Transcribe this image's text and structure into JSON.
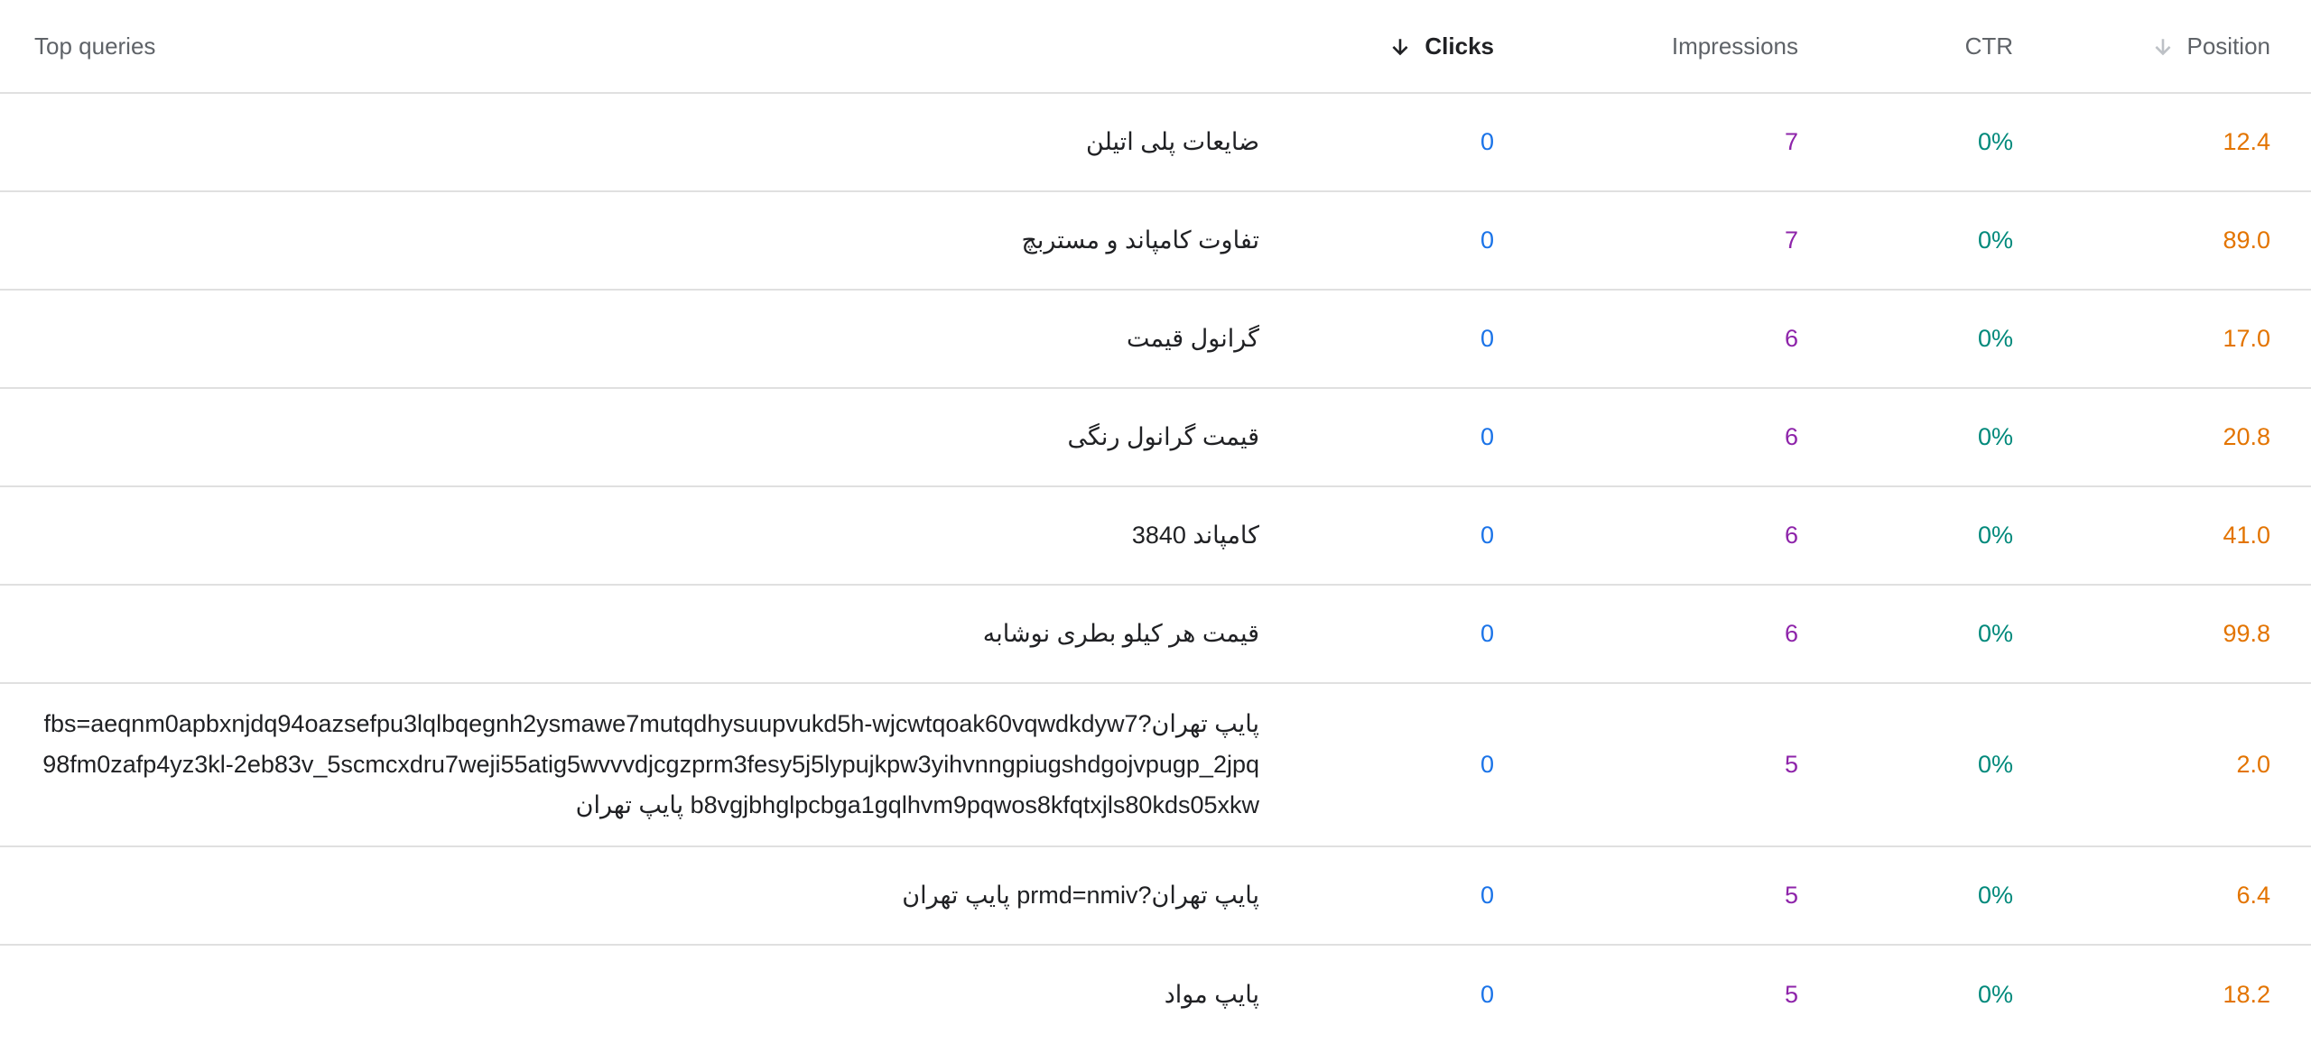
{
  "header": {
    "query_label": "Top queries",
    "clicks_label": "Clicks",
    "impressions_label": "Impressions",
    "ctr_label": "CTR",
    "position_label": "Position"
  },
  "icons": {
    "clicks_sort": "arrow-down-icon",
    "position_sort": "arrow-down-icon"
  },
  "colors": {
    "clicks": "#1a73e8",
    "impressions": "#8e24aa",
    "ctr": "#00897b",
    "position": "#e37400"
  },
  "rows": [
    {
      "query": "ضایعات پلی اتیلن",
      "clicks": "0",
      "impressions": "7",
      "ctr": "0%",
      "position": "12.4"
    },
    {
      "query": "تفاوت کامپاند و مستربچ",
      "clicks": "0",
      "impressions": "7",
      "ctr": "0%",
      "position": "89.0"
    },
    {
      "query": "گرانول قیمت",
      "clicks": "0",
      "impressions": "6",
      "ctr": "0%",
      "position": "17.0"
    },
    {
      "query": "قیمت گرانول رنگی",
      "clicks": "0",
      "impressions": "6",
      "ctr": "0%",
      "position": "20.8"
    },
    {
      "query": "کامپاند 3840",
      "clicks": "0",
      "impressions": "6",
      "ctr": "0%",
      "position": "41.0"
    },
    {
      "query": "قیمت هر کیلو بطری نوشابه",
      "clicks": "0",
      "impressions": "6",
      "ctr": "0%",
      "position": "99.8"
    },
    {
      "query": "پایپ تهران?fbs=aeqnm0apbxnjdq94oazsefpu3lqlbqegnh2ysmawe7mutqdhysuupvukd5h-wjcwtqoak60vqwdkdyw798fm0zafp4yz3kl-2eb83v_5scmcxdru7weji55atig5wvvvdjcgzprm3fesy5j5lypujkpw3yihvnngpiugshdgojvpugp_2jpqb8vgjbhglpcbga1gqlhvm9pqwos8kfqtxjls80kds05xkw پایپ تهران",
      "clicks": "0",
      "impressions": "5",
      "ctr": "0%",
      "position": "2.0"
    },
    {
      "query": "پایپ تهران?prmd=nmiv پایپ تهران",
      "clicks": "0",
      "impressions": "5",
      "ctr": "0%",
      "position": "6.4"
    },
    {
      "query": "پایپ مواد",
      "clicks": "0",
      "impressions": "5",
      "ctr": "0%",
      "position": "18.2"
    }
  ]
}
